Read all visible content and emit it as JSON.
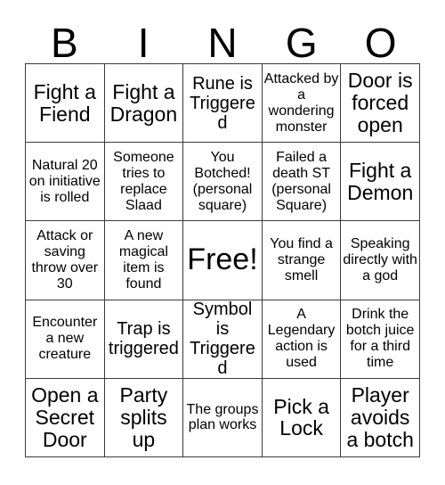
{
  "card": {
    "header_letters": [
      "B",
      "I",
      "N",
      "G",
      "O"
    ],
    "columns": 5,
    "rows": 5,
    "border_color": "#3a3a3a",
    "background_color": "#ffffff",
    "text_color": "#000000",
    "free_space_index": {
      "row": 2,
      "col": 2
    },
    "squares": [
      [
        {
          "text": "Fight a Fiend",
          "size": "xl"
        },
        {
          "text": "Fight a Dragon",
          "size": "xl"
        },
        {
          "text": "Rune is Triggered",
          "size": "lg"
        },
        {
          "text": "Attacked by a wondering monster",
          "size": "md"
        },
        {
          "text": "Door is forced open",
          "size": "xl"
        }
      ],
      [
        {
          "text": "Natural 20 on initiative is rolled",
          "size": "md"
        },
        {
          "text": "Someone tries to replace Slaad",
          "size": "md"
        },
        {
          "text": "You Botched! (personal square)",
          "size": "md"
        },
        {
          "text": "Failed a death ST (personal Square)",
          "size": "md"
        },
        {
          "text": "Fight a Demon",
          "size": "xl"
        }
      ],
      [
        {
          "text": "Attack or saving throw over 30",
          "size": "md"
        },
        {
          "text": "A new magical item is found",
          "size": "md"
        },
        {
          "text": "Free!",
          "size": "xxl"
        },
        {
          "text": "You find a strange smell",
          "size": "md"
        },
        {
          "text": "Speaking directly with a god",
          "size": "md"
        }
      ],
      [
        {
          "text": "Encounter a new creature",
          "size": "md"
        },
        {
          "text": "Trap is triggered",
          "size": "lg"
        },
        {
          "text": "Symbol is Triggered",
          "size": "lg"
        },
        {
          "text": "A Legendary action is used",
          "size": "md"
        },
        {
          "text": "Drink the botch juice for a third time",
          "size": "md"
        }
      ],
      [
        {
          "text": "Open a Secret Door",
          "size": "xl"
        },
        {
          "text": "Party splits up",
          "size": "xl"
        },
        {
          "text": "The groups plan works",
          "size": "md"
        },
        {
          "text": "Pick a Lock",
          "size": "xl"
        },
        {
          "text": "Player avoids a botch",
          "size": "xl"
        }
      ]
    ]
  }
}
